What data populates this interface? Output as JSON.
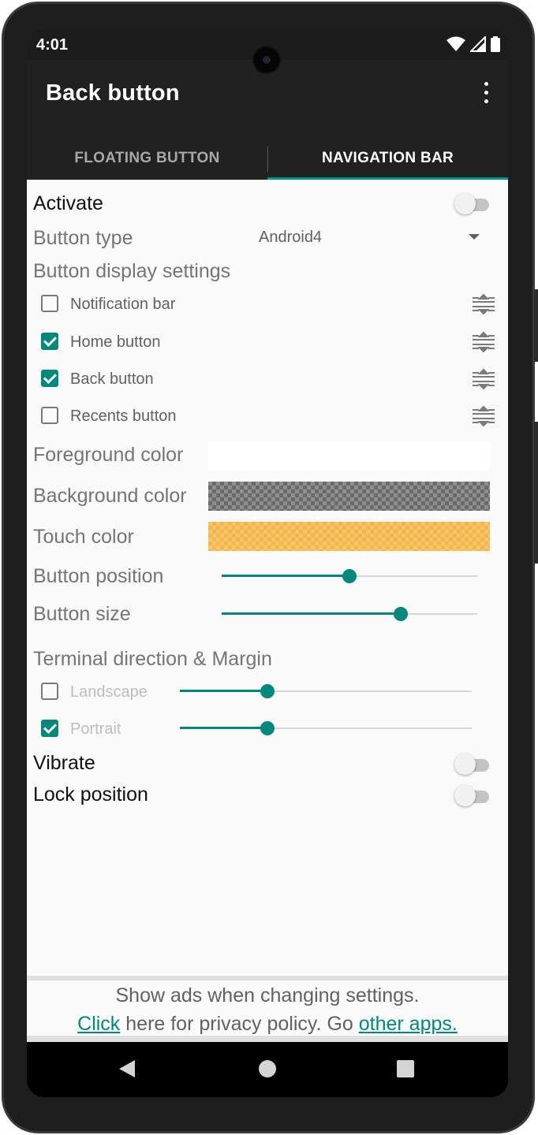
{
  "status": {
    "time": "4:01"
  },
  "appbar": {
    "title": "Back button"
  },
  "tabs": [
    {
      "label": "FLOATING BUTTON",
      "active": false
    },
    {
      "label": "NAVIGATION BAR",
      "active": true
    }
  ],
  "settings": {
    "activate": {
      "label": "Activate",
      "on": false
    },
    "button_type": {
      "label": "Button type",
      "value": "Android4"
    },
    "display_settings": {
      "label": "Button display settings",
      "items": [
        {
          "label": "Notification bar",
          "checked": false
        },
        {
          "label": "Home button",
          "checked": true
        },
        {
          "label": "Back button",
          "checked": true
        },
        {
          "label": "Recents button",
          "checked": false
        }
      ]
    },
    "colors": {
      "foreground": {
        "label": "Foreground color",
        "value": "#ffffff"
      },
      "background": {
        "label": "Background color",
        "value": "#8f8f8f"
      },
      "touch": {
        "label": "Touch color",
        "value": "#f8c66a"
      }
    },
    "button_position": {
      "label": "Button position",
      "value": 0.5
    },
    "button_size": {
      "label": "Button size",
      "value": 0.7
    },
    "terminal": {
      "label": "Terminal direction & Margin",
      "landscape": {
        "label": "Landscape",
        "checked": false,
        "value": 0.3
      },
      "portrait": {
        "label": "Portrait",
        "checked": true,
        "value": 0.3
      }
    },
    "vibrate": {
      "label": "Vibrate",
      "on": false
    },
    "lock_position": {
      "label": "Lock position",
      "on": false
    }
  },
  "ads": {
    "line1": "Show ads when changing settings.",
    "click_link": "Click",
    "middle_text": " here for privacy policy. Go ",
    "other_link": "other apps."
  },
  "colors": {
    "accent": "#00897b",
    "appbar": "#212121",
    "content_bg": "#fafafa"
  },
  "icons": {
    "back": "triangle-back-icon",
    "home": "circle-home-icon",
    "recents": "square-recents-icon"
  }
}
